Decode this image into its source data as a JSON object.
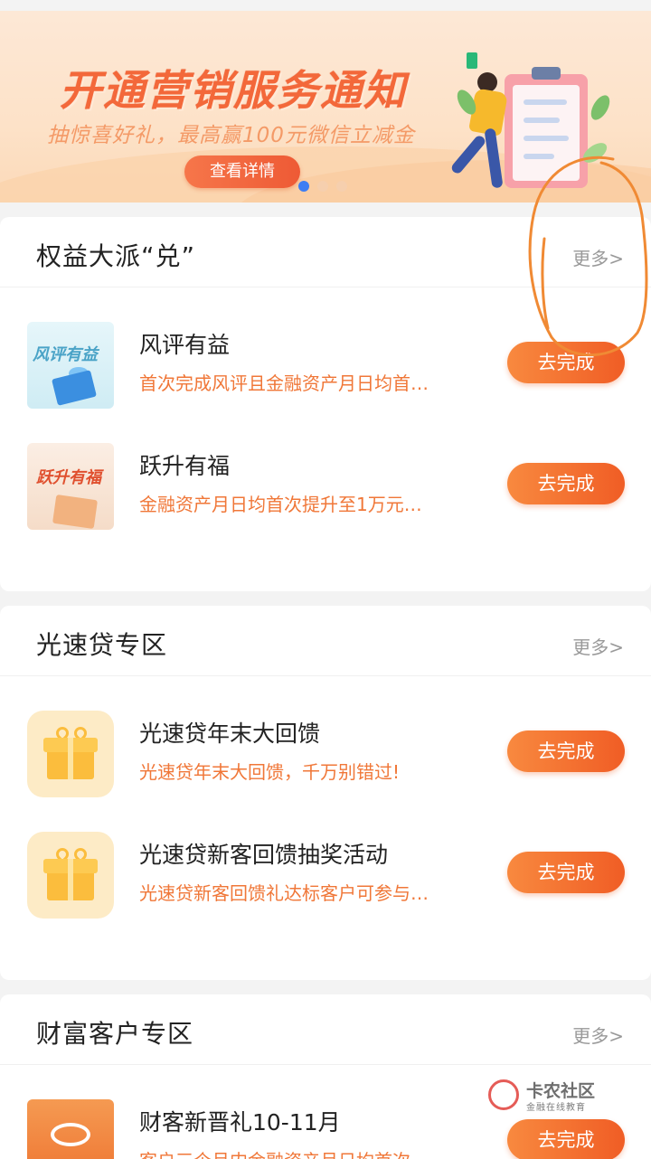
{
  "banner": {
    "title": "开通营销服务通知",
    "subtitle": "抽惊喜好礼，最高赢100元微信立减金",
    "button_label": "查看详情",
    "page_count": 3,
    "active_page": 1
  },
  "sections": [
    {
      "title": "权益大派“兑”",
      "more_label": "更多>",
      "items": [
        {
          "thumb_text": "风评有益",
          "title": "风评有益",
          "desc": "首次完成风评且金融资产月日均首…",
          "button": "去完成"
        },
        {
          "thumb_text": "跃升有福",
          "title": "跃升有福",
          "desc": "金融资产月日均首次提升至1万元…",
          "button": "去完成"
        }
      ]
    },
    {
      "title": "光速贷专区",
      "more_label": "更多>",
      "items": [
        {
          "title": "光速贷年末大回馈",
          "desc": "光速贷年末大回馈，千万别错过!",
          "button": "去完成"
        },
        {
          "title": "光速贷新客回馈抽奖活动",
          "desc": "光速贷新客回馈礼达标客户可参与…",
          "button": "去完成"
        }
      ]
    },
    {
      "title": "财富客户专区",
      "more_label": "更多>",
      "items": [
        {
          "title": "财客新晋礼10-11月",
          "desc": "客户三个月内金融资产月日均首次",
          "button": "去完成"
        }
      ]
    }
  ],
  "watermark": {
    "name": "卡农社区",
    "tagline": "金融在线教育"
  },
  "colors": {
    "accent": "#f05d25",
    "desc_text": "#f07738",
    "banner_title": "#f3683a",
    "scribble": "#f08a34"
  }
}
